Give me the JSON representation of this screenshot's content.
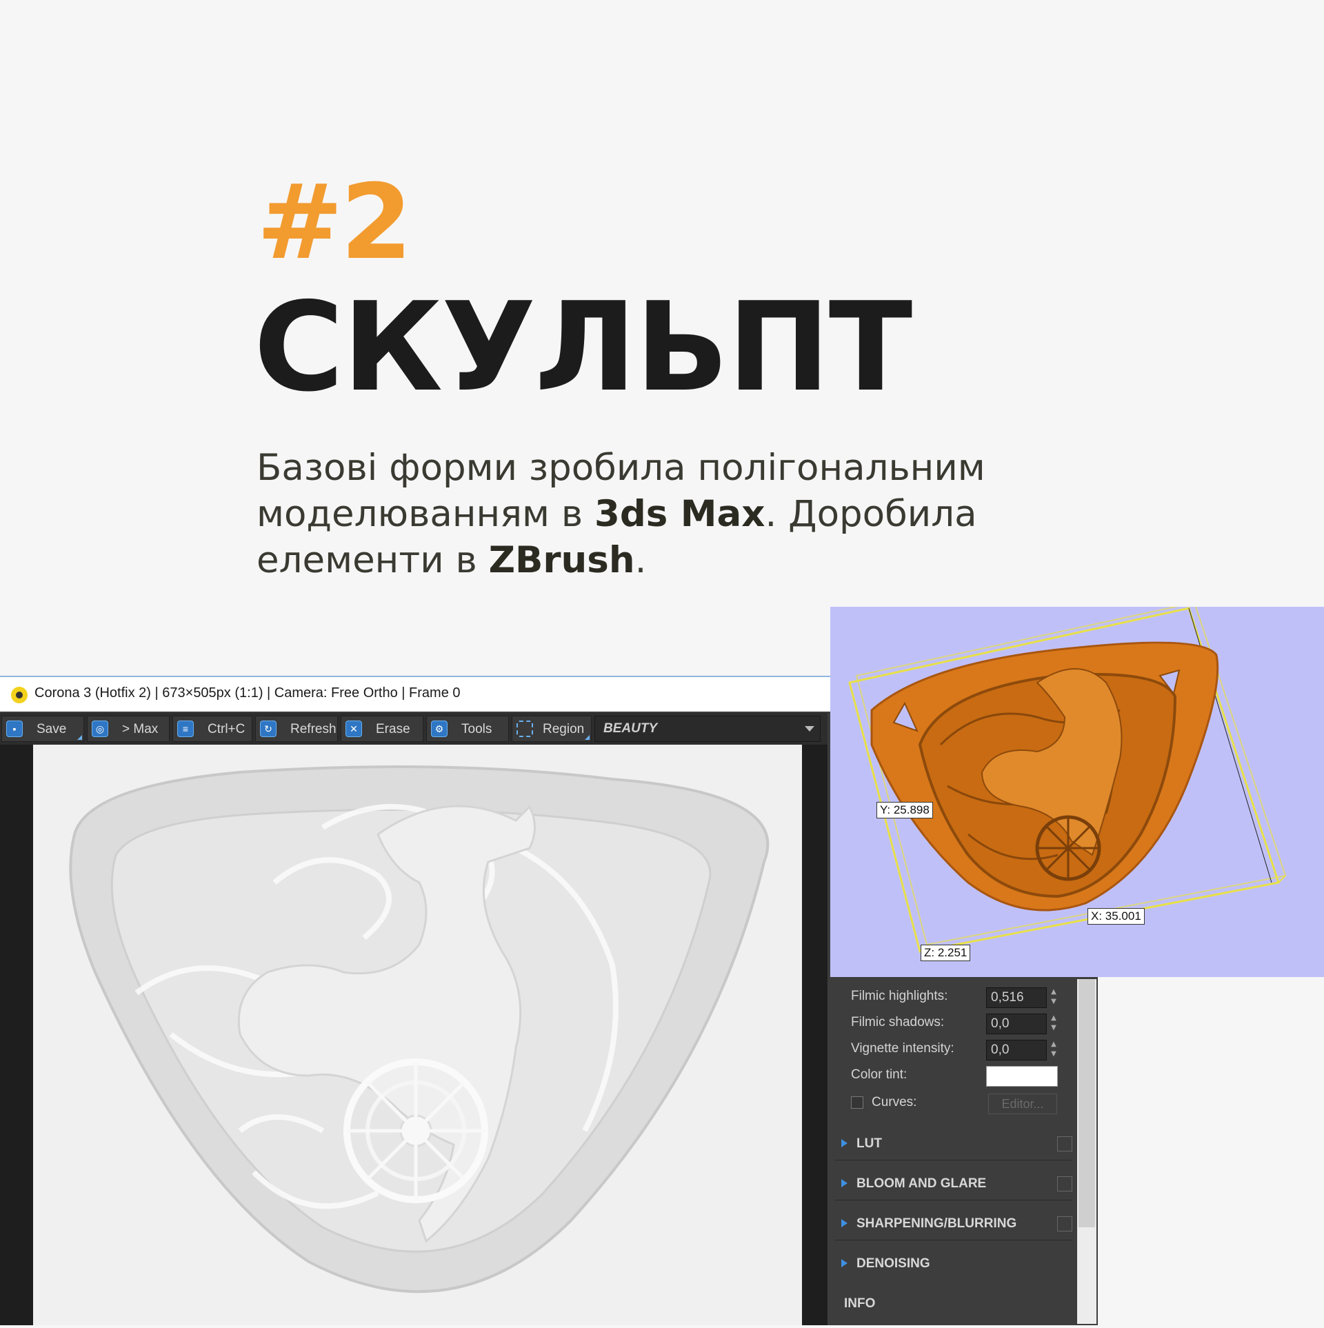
{
  "headline": {
    "number": "#2",
    "title": "СКУЛЬПТ",
    "description": {
      "part1": "Базові форми зробила полігональним моделюванням в ",
      "tool1": "3ds Max",
      "part2": ". Доробила елементи в ",
      "tool2": "ZBrush",
      "part3": "."
    }
  },
  "vfb": {
    "title": "Corona 3 (Hotfix 2) | 673×505px (1:1) | Camera: Free Ortho | Frame 0",
    "toolbar": {
      "save": "Save",
      "to_max": "> Max",
      "copy": "Ctrl+C",
      "refresh": "Refresh",
      "erase": "Erase",
      "tools": "Tools",
      "region": "Region",
      "channel": "BEAUTY"
    },
    "panel": {
      "filmic_highlights_label": "Filmic highlights:",
      "filmic_highlights_value": "0,516",
      "filmic_shadows_label": "Filmic shadows:",
      "filmic_shadows_value": "0,0",
      "vignette_label": "Vignette intensity:",
      "vignette_value": "0,0",
      "color_tint_label": "Color tint:",
      "curves_label": "Curves:",
      "editor_button": "Editor...",
      "sections": [
        "LUT",
        "BLOOM AND GLARE",
        "SHARPENING/BLURRING",
        "DENOISING",
        "INFO"
      ]
    }
  },
  "viewport": {
    "dim_y": "Y: 25.898",
    "dim_x": "X: 35.001",
    "dim_z": "Z: 2.251"
  },
  "colors": {
    "accent": "#f29b2f",
    "title": "#1c1c1c",
    "viewport_bg": "#c0c0f9",
    "model": "#d9781a"
  }
}
